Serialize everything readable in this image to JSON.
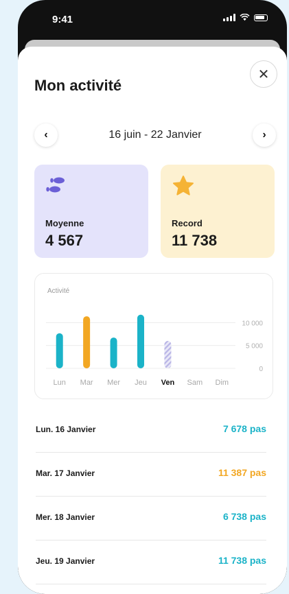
{
  "status_bar": {
    "time": "9:41"
  },
  "header": {
    "title": "Mon activité",
    "close_icon": "close-icon"
  },
  "date_nav": {
    "range": "16 juin - 22 Janvier",
    "prev_icon": "chevron-left-icon",
    "next_icon": "chevron-right-icon"
  },
  "cards": {
    "average": {
      "label": "Moyenne",
      "value": "4 567",
      "icon": "footsteps-icon"
    },
    "record": {
      "label": "Record",
      "value": "11 738",
      "icon": "star-icon"
    }
  },
  "colors": {
    "teal": "#1bb3c8",
    "orange": "#f2a723",
    "star": "#f5b335",
    "steps_icon": "#6b5fd6"
  },
  "chart_data": {
    "type": "bar",
    "title": "Activité",
    "categories": [
      "Lun",
      "Mar",
      "Mer",
      "Jeu",
      "Ven",
      "Sam",
      "Dim"
    ],
    "values": [
      7678,
      11387,
      6738,
      11738,
      6000,
      0,
      0
    ],
    "bar_colors": [
      "teal",
      "orange",
      "teal",
      "teal",
      "striped-lavender",
      "none",
      "none"
    ],
    "current_day": "Ven",
    "y_ticks": [
      "10 000",
      "5 000",
      "0"
    ],
    "ylim": [
      0,
      12000
    ],
    "grid": true
  },
  "days": [
    {
      "date": "Lun. 16 Janvier",
      "steps": "7 678 pas",
      "color": "#1bb3c8"
    },
    {
      "date": "Mar. 17 Janvier",
      "steps": "11 387 pas",
      "color": "#f2a723"
    },
    {
      "date": "Mer. 18 Janvier",
      "steps": "6 738 pas",
      "color": "#1bb3c8"
    },
    {
      "date": "Jeu. 19 Janvier",
      "steps": "11 738 pas",
      "color": "#1bb3c8"
    }
  ]
}
